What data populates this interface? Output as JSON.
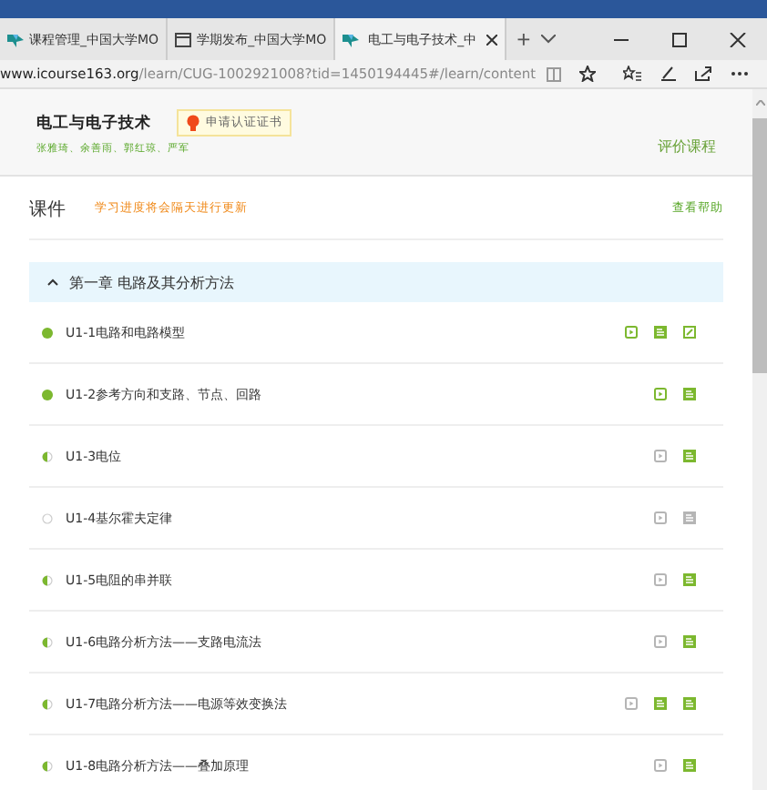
{
  "browser": {
    "tabs": [
      {
        "label": "课程管理_中国大学MO",
        "selected": false,
        "kind": "site"
      },
      {
        "label": "学期发布_中国大学MO",
        "selected": false,
        "kind": "page"
      },
      {
        "label": "电工与电子技术_中",
        "selected": true,
        "kind": "site"
      }
    ],
    "new_tab": "+",
    "address": {
      "host": "www.icourse163.org",
      "path": "/learn/CUG-1002921008?tid=1450194445#/learn/content"
    }
  },
  "course": {
    "title": "电工与电子技术",
    "teachers": "张雅琦、余善雨、郭红琼、严军",
    "certificate": "申请认证证书",
    "rate": "评价课程"
  },
  "section": {
    "title": "课件",
    "note": "学习进度将会隔天进行更新",
    "help": "查看帮助"
  },
  "chapter": {
    "title": "第一章 电路及其分析方法",
    "expanded": true
  },
  "lessons": [
    {
      "title": "U1-1电路和电路模型",
      "level": 1,
      "resources": [
        {
          "kind": "video",
          "done": true
        },
        {
          "kind": "doc",
          "done": true
        },
        {
          "kind": "exercise",
          "done": true
        }
      ]
    },
    {
      "title": "U1-2参考方向和支路、节点、回路",
      "level": 1,
      "resources": [
        {
          "kind": "video",
          "done": true
        },
        {
          "kind": "doc",
          "done": true
        }
      ]
    },
    {
      "title": "U1-3电位",
      "level": 0.5,
      "resources": [
        {
          "kind": "video",
          "done": false
        },
        {
          "kind": "doc",
          "done": true
        }
      ]
    },
    {
      "title": "U1-4基尔霍夫定律",
      "level": 0,
      "resources": [
        {
          "kind": "video",
          "done": false
        },
        {
          "kind": "doc",
          "done": false
        }
      ]
    },
    {
      "title": "U1-5电阻的串并联",
      "level": 0.5,
      "resources": [
        {
          "kind": "video",
          "done": false
        },
        {
          "kind": "doc",
          "done": true
        }
      ]
    },
    {
      "title": "U1-6电路分析方法——支路电流法",
      "level": 0.5,
      "resources": [
        {
          "kind": "video",
          "done": false
        },
        {
          "kind": "doc",
          "done": true
        }
      ]
    },
    {
      "title": "U1-7电路分析方法——电源等效变换法",
      "level": 0.5,
      "resources": [
        {
          "kind": "video",
          "done": false
        },
        {
          "kind": "doc",
          "done": true
        },
        {
          "kind": "doc",
          "done": true
        }
      ]
    },
    {
      "title": "U1-8电路分析方法——叠加原理",
      "level": 0.5,
      "resources": [
        {
          "kind": "video",
          "done": false
        },
        {
          "kind": "doc",
          "done": true
        }
      ]
    }
  ]
}
